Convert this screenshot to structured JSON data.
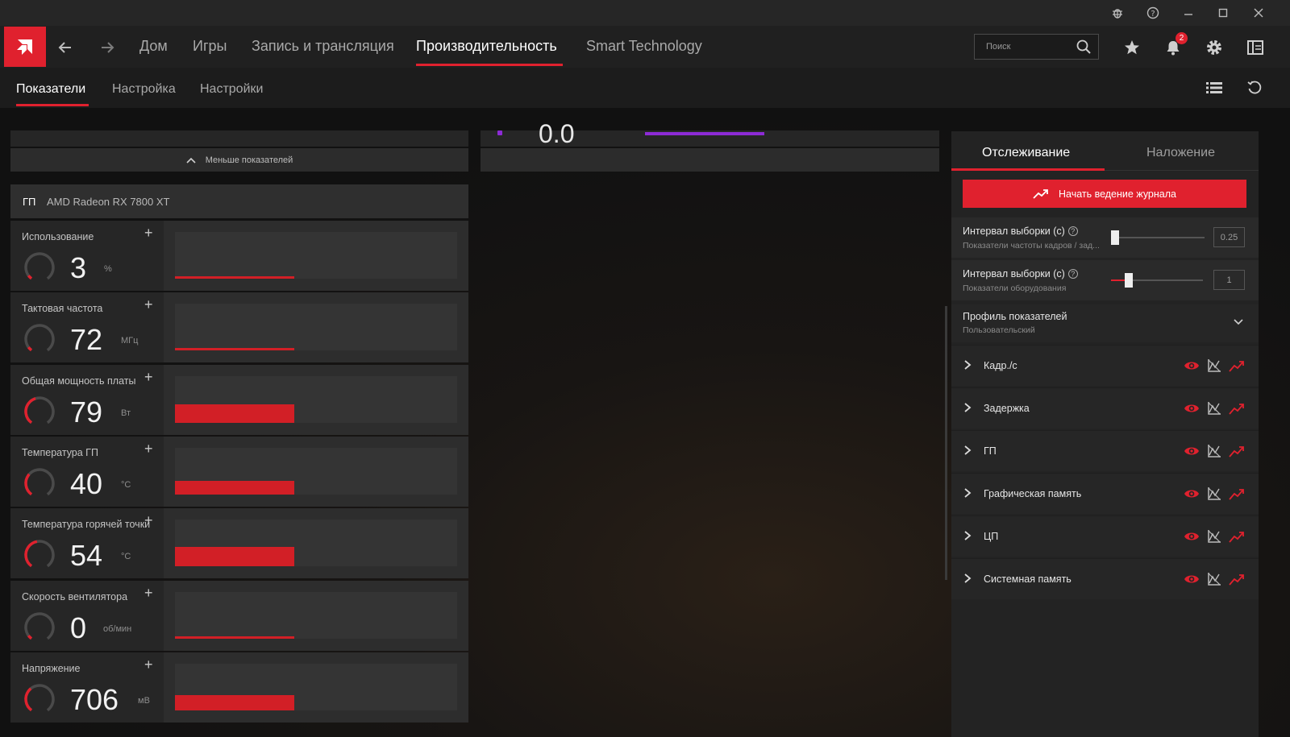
{
  "topnav": {
    "tabs": [
      {
        "label": "Дом"
      },
      {
        "label": "Игры"
      },
      {
        "label": "Запись и трансляция"
      },
      {
        "label": "Производительность"
      },
      {
        "label": "Smart Technology"
      }
    ],
    "search_placeholder": "Поиск",
    "notification_count": "2"
  },
  "subnav": {
    "tabs": [
      {
        "label": "Показатели"
      },
      {
        "label": "Настройка"
      },
      {
        "label": "Настройки"
      }
    ]
  },
  "left": {
    "less_metrics_label": "Меньше показателей",
    "gpu_header_short": "ГП",
    "gpu_name": "AMD  Radeon RX 7800 XT",
    "metrics": [
      {
        "label": "Использование",
        "value": "3",
        "unit": "%",
        "bar_level": 0.03
      },
      {
        "label": "Тактовая частота",
        "value": "72",
        "unit": "МГц",
        "bar_level": 0.03
      },
      {
        "label": "Общая мощность платы",
        "value": "79",
        "unit": "Вт",
        "bar_level": 0.4
      },
      {
        "label": "Температура ГП",
        "value": "40",
        "unit": "°C",
        "bar_level": 0.3
      },
      {
        "label": "Температура горячей точки",
        "value": "54",
        "unit": "°C",
        "bar_level": 0.42
      },
      {
        "label": "Скорость вентилятора",
        "value": "0",
        "unit": "об/мин",
        "bar_level": 0.02
      },
      {
        "label": "Напряжение",
        "value": "706",
        "unit": "мВ",
        "bar_level": 0.33
      }
    ]
  },
  "middle": {
    "partial_value": "0.0"
  },
  "right": {
    "tabs": [
      {
        "label": "Отслеживание"
      },
      {
        "label": "Наложение"
      }
    ],
    "log_button": "Начать ведение журнала",
    "settings": [
      {
        "title": "Интервал выборки (с)",
        "subtitle": "Показатели частоты кадров / зад...",
        "value": "0.25"
      },
      {
        "title": "Интервал выборки (с)",
        "subtitle": "Показатели оборудования",
        "value": "1"
      }
    ],
    "profile": {
      "title": "Профиль показателей",
      "value": "Пользовательский"
    },
    "categories": [
      {
        "label": "Кадр./с"
      },
      {
        "label": "Задержка"
      },
      {
        "label": "ГП"
      },
      {
        "label": "Графическая память"
      },
      {
        "label": "ЦП"
      },
      {
        "label": "Системная память"
      }
    ]
  },
  "colors": {
    "accent": "#e0212e",
    "purple": "#8d2bd6"
  }
}
